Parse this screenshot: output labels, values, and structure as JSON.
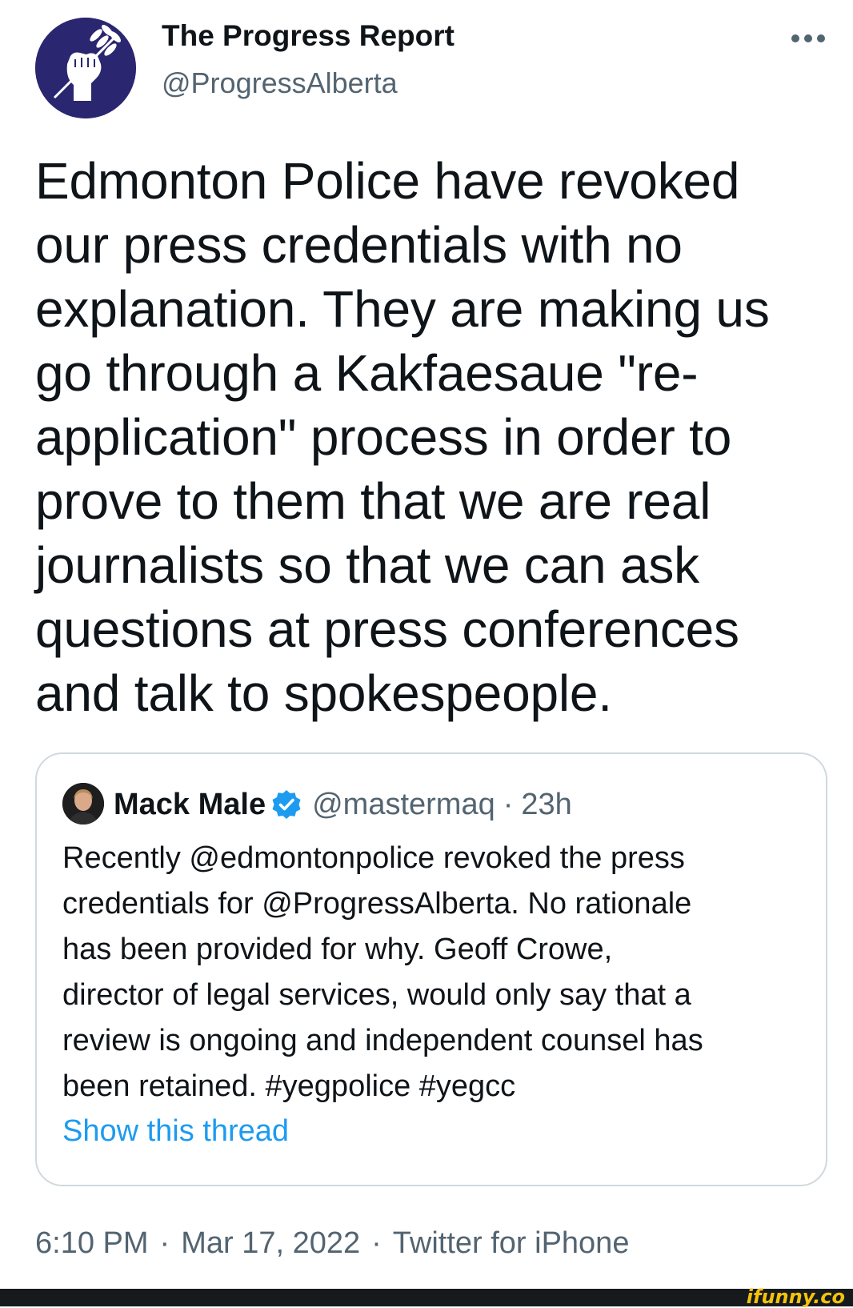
{
  "tweet": {
    "display_name": "The Progress Report",
    "handle": "@ProgressAlberta",
    "text": "Edmonton Police have revoked\nour press credentials with no\nexplanation. They are making us\ngo through a Kakfaesaue \"re-\napplication\" process in order to\nprove to them that we are real\njournalists so that we can ask\nquestions at press conferences\nand talk to spokespeople.",
    "time": "6:10 PM",
    "date": "Mar 17, 2022",
    "source": "Twitter for iPhone",
    "separator": "·",
    "more_icon": "ellipsis-icon",
    "avatar_icon": "raised-fist-wheat-icon",
    "avatar_bg": "#2a2670"
  },
  "quote": {
    "display_name": "Mack Male",
    "handle": "@mastermaq",
    "separator": "·",
    "time": "23h",
    "verified_icon": "verified-badge-icon",
    "verified_color": "#1d9bf0",
    "text": "Recently @edmontonpolice revoked the press\ncredentials for @ProgressAlberta. No rationale\nhas been provided for why. Geoff Crowe,\ndirector of legal services, would only say that a\nreview is ongoing and independent counsel has\nbeen retained. #yegpolice #yegcc",
    "show_thread": "Show this thread",
    "link_color": "#1d9bf0"
  },
  "watermark": {
    "text": "ifunny.co",
    "color": "#f4c20d"
  }
}
